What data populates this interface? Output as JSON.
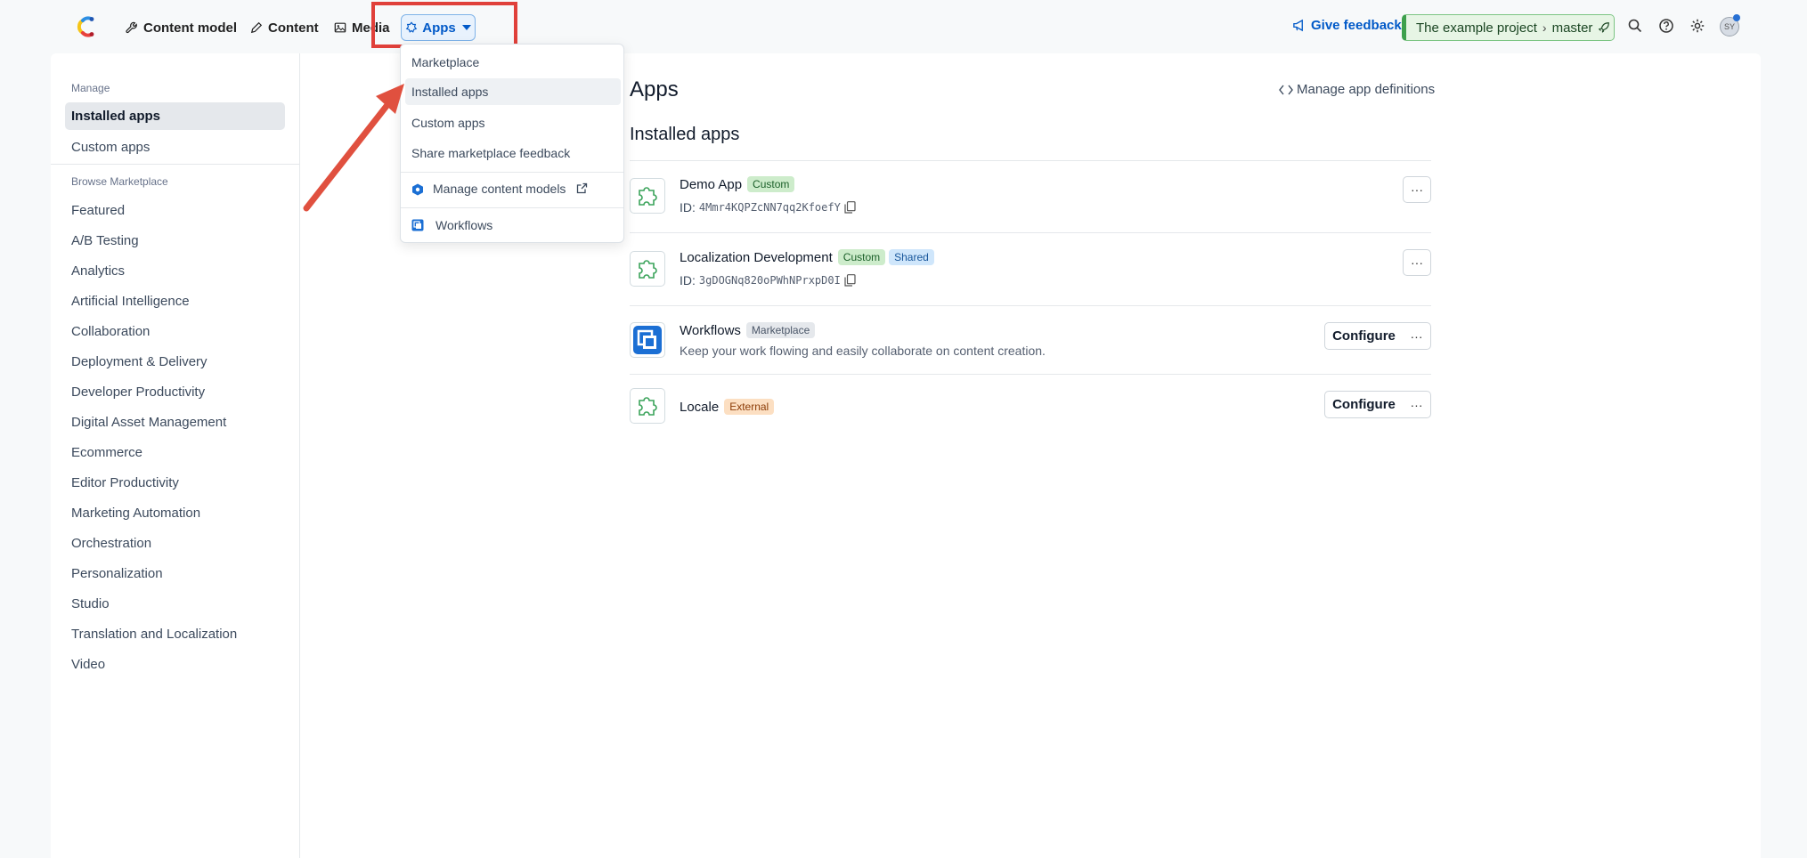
{
  "topnav": {
    "items": [
      {
        "label": "Content model",
        "icon": "wrench-icon"
      },
      {
        "label": "Content",
        "icon": "pen-icon"
      },
      {
        "label": "Media",
        "icon": "image-icon"
      }
    ],
    "apps_label": "Apps",
    "feedback_label": "Give feedback",
    "env_project": "The example project",
    "env_branch": "master",
    "avatar_initials": "SY"
  },
  "dropdown": {
    "items": [
      "Marketplace",
      "Installed apps",
      "Custom apps",
      "Share marketplace feedback"
    ],
    "manage_content_models": "Manage content models",
    "workflows": "Workflows"
  },
  "sidebar": {
    "manage_heading": "Manage",
    "manage_items": [
      "Installed apps",
      "Custom apps"
    ],
    "browse_heading": "Browse Marketplace",
    "browse_items": [
      "Featured",
      "A/B Testing",
      "Analytics",
      "Artificial Intelligence",
      "Collaboration",
      "Deployment & Delivery",
      "Developer Productivity",
      "Digital Asset Management",
      "Ecommerce",
      "Editor Productivity",
      "Marketing Automation",
      "Orchestration",
      "Personalization",
      "Studio",
      "Translation and Localization",
      "Video"
    ]
  },
  "main": {
    "title": "Apps",
    "manage_definitions": "Manage app definitions",
    "section_title": "Installed apps",
    "id_label": "ID:",
    "configure_label": "Configure",
    "more_label": "···",
    "apps": [
      {
        "name": "Demo App",
        "badges": [
          "Custom"
        ],
        "id": "4Mmr4KQPZcNN7qq2KfoefY"
      },
      {
        "name": "Localization Development",
        "badges": [
          "Custom",
          "Shared"
        ],
        "id": "3gDOGNq820oPWhNPrxpD0I"
      },
      {
        "name": "Workflows",
        "badges": [
          "Marketplace"
        ],
        "description": "Keep your work flowing and easily collaborate on content creation."
      },
      {
        "name": "Locale",
        "badges": [
          "External"
        ]
      }
    ]
  },
  "colors": {
    "accent": "#0059c8",
    "highlight": "#e0403a",
    "env_green": "#3ea04d"
  }
}
